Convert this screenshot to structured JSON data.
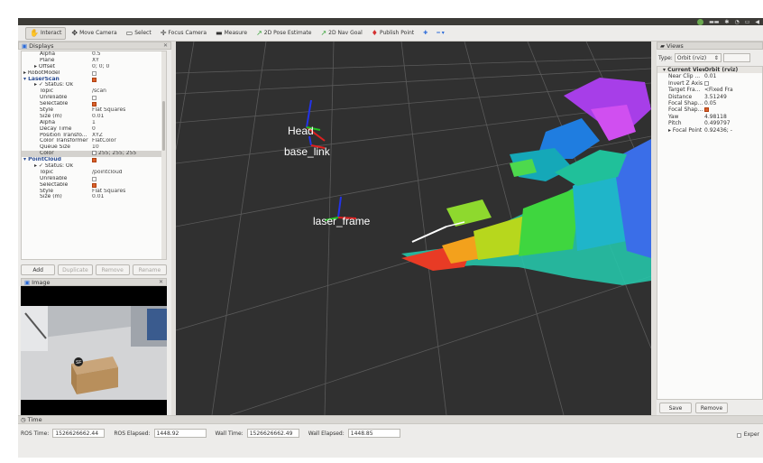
{
  "toolbar": {
    "tools": [
      {
        "name": "interact",
        "label": "Interact",
        "icon": "cursor-icon",
        "glyph": "✋",
        "active": true
      },
      {
        "name": "move-camera",
        "label": "Move Camera",
        "icon": "move-icon",
        "glyph": "✥",
        "active": false
      },
      {
        "name": "select",
        "label": "Select",
        "icon": "select-icon",
        "glyph": "▭",
        "active": false
      },
      {
        "name": "focus-camera",
        "label": "Focus Camera",
        "icon": "focus-icon",
        "glyph": "✛",
        "active": false
      },
      {
        "name": "measure",
        "label": "Measure",
        "icon": "ruler-icon",
        "glyph": "▬",
        "active": false
      },
      {
        "name": "2d-pose-estimate",
        "label": "2D Pose Estimate",
        "icon": "green-arrow-icon",
        "glyph": "↗",
        "active": false
      },
      {
        "name": "2d-nav-goal",
        "label": "2D Nav Goal",
        "icon": "green-arrow-icon",
        "glyph": "↗",
        "active": false
      },
      {
        "name": "publish-point",
        "label": "Publish Point",
        "icon": "pin-icon",
        "glyph": "♦",
        "active": false
      }
    ]
  },
  "displays": {
    "title": "Displays",
    "rows": [
      {
        "k": "Alpha",
        "v": "0.5",
        "indent": 3
      },
      {
        "k": "Plane",
        "v": "XY",
        "indent": 3
      },
      {
        "k": "▸ Offset",
        "v": "0; 0; 0",
        "indent": 2
      },
      {
        "k": "▸ RobotModel",
        "v": "",
        "indent": 0,
        "chk": "off"
      },
      {
        "k": "▾ LaserScan",
        "v": "",
        "indent": 0,
        "chk": "on",
        "hdr": true
      },
      {
        "k": "▸ ✓ Status: Ok",
        "v": "",
        "indent": 2
      },
      {
        "k": "Topic",
        "v": "/scan",
        "indent": 3
      },
      {
        "k": "Unreliable",
        "v": "",
        "indent": 3,
        "chk": "off"
      },
      {
        "k": "Selectable",
        "v": "",
        "indent": 3,
        "chk": "on"
      },
      {
        "k": "Style",
        "v": "Flat Squares",
        "indent": 3
      },
      {
        "k": "Size (m)",
        "v": "0.01",
        "indent": 3
      },
      {
        "k": "Alpha",
        "v": "1",
        "indent": 3
      },
      {
        "k": "Decay Time",
        "v": "0",
        "indent": 3
      },
      {
        "k": "Position Transfo...",
        "v": "XYZ",
        "indent": 3
      },
      {
        "k": "Color Transformer",
        "v": "FlatColor",
        "indent": 3
      },
      {
        "k": "Queue Size",
        "v": "10",
        "indent": 3
      },
      {
        "k": "Color",
        "v": "255; 255; 255",
        "indent": 3,
        "swatch": true,
        "sel": true
      },
      {
        "k": "▾ PointCloud",
        "v": "",
        "indent": 0,
        "chk": "on",
        "hdr": true
      },
      {
        "k": "▸ ✓ Status: Ok",
        "v": "",
        "indent": 2
      },
      {
        "k": "Topic",
        "v": "/pointcloud",
        "indent": 3
      },
      {
        "k": "Unreliable",
        "v": "",
        "indent": 3,
        "chk": "off"
      },
      {
        "k": "Selectable",
        "v": "",
        "indent": 3,
        "chk": "on"
      },
      {
        "k": "Style",
        "v": "Flat Squares",
        "indent": 3
      },
      {
        "k": "Size (m)",
        "v": "0.01",
        "indent": 3
      }
    ],
    "buttons": {
      "add": "Add",
      "duplicate": "Duplicate",
      "remove": "Remove",
      "rename": "Rename"
    }
  },
  "image_panel": {
    "title": "Image"
  },
  "scene": {
    "labels": {
      "head": "Head",
      "base": "base_link",
      "laser": "laser_frame"
    }
  },
  "views": {
    "title": "Views",
    "type_label": "Type:",
    "type_value": "Orbit (rviz)",
    "rows": [
      {
        "k": "▾ Current View",
        "v": "Orbit (rviz)",
        "hd": true
      },
      {
        "k": "Near Clip ...",
        "v": "0.01"
      },
      {
        "k": "Invert Z Axis",
        "v": "",
        "chk": "off"
      },
      {
        "k": "Target Fra...",
        "v": "<Fixed Fra"
      },
      {
        "k": "Distance",
        "v": "3.51249"
      },
      {
        "k": "Focal Shap...",
        "v": "0.05"
      },
      {
        "k": "Focal Shap...",
        "v": "",
        "chk": "on"
      },
      {
        "k": "Yaw",
        "v": "4.98118"
      },
      {
        "k": "Pitch",
        "v": "0.499797"
      },
      {
        "k": "▸ Focal Point",
        "v": "0.92436; -"
      }
    ],
    "save": "Save",
    "remove": "Remove"
  },
  "time": {
    "title": "Time",
    "ros_time_label": "ROS Time:",
    "ros_time": "1526626662.44",
    "ros_elapsed_label": "ROS Elapsed:",
    "ros_elapsed": "1448.92",
    "wall_time_label": "Wall Time:",
    "wall_time": "1526626662.49",
    "wall_elapsed_label": "Wall Elapsed:",
    "wall_elapsed": "1448.85",
    "experimental": "Exper"
  }
}
